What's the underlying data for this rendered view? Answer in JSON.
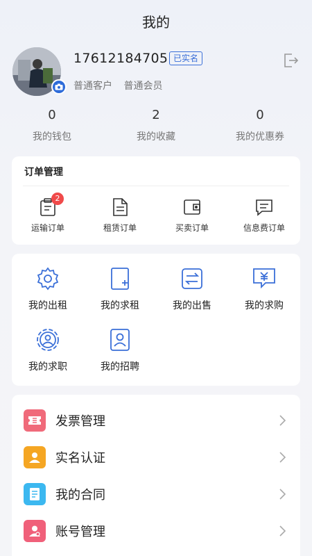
{
  "header": {
    "title": "我的"
  },
  "profile": {
    "phone": "17612184705",
    "verified_label": "已实名",
    "tags": [
      "普通客户",
      "普通会员"
    ]
  },
  "stats": [
    {
      "value": "0",
      "label": "我的钱包"
    },
    {
      "value": "2",
      "label": "我的收藏"
    },
    {
      "value": "0",
      "label": "我的优惠券"
    }
  ],
  "orders": {
    "title": "订单管理",
    "items": [
      {
        "label": "运输订单",
        "icon": "clipboard-icon",
        "badge": "2"
      },
      {
        "label": "租赁订单",
        "icon": "document-icon"
      },
      {
        "label": "买卖订单",
        "icon": "wallet-icon"
      },
      {
        "label": "信息费订单",
        "icon": "message-icon"
      }
    ]
  },
  "services": [
    {
      "label": "我的出租",
      "icon": "gear-icon"
    },
    {
      "label": "我的求租",
      "icon": "add-page-icon"
    },
    {
      "label": "我的出售",
      "icon": "exchange-icon"
    },
    {
      "label": "我的求购",
      "icon": "yuan-chat-icon"
    },
    {
      "label": "我的求职",
      "icon": "person-circle-icon"
    },
    {
      "label": "我的招聘",
      "icon": "person-card-icon"
    }
  ],
  "menu": [
    {
      "label": "发票管理",
      "icon": "invoice-icon",
      "color": "#f06a7a"
    },
    {
      "label": "实名认证",
      "icon": "id-icon",
      "color": "#f5a623"
    },
    {
      "label": "我的合同",
      "icon": "contract-icon",
      "color": "#3cb8f0"
    },
    {
      "label": "账号管理",
      "icon": "account-icon",
      "color": "#f0607a"
    }
  ],
  "colors": {
    "accent": "#2d6bd9",
    "badge": "#f04a4a"
  }
}
